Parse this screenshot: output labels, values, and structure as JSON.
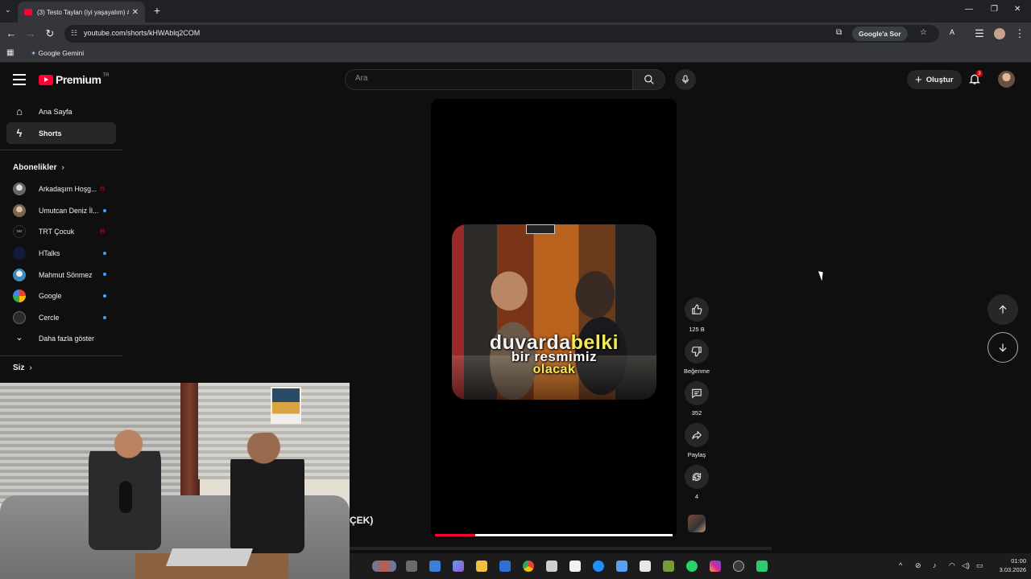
{
  "browser": {
    "tab_title": "(3) Testo Taylan (iyi yaşayalım) #",
    "url": "youtube.com/shorts/kHWAblq2COM",
    "ask_google": "Google'a Sor",
    "bookmark": "Google Gemini"
  },
  "header": {
    "logo": "Premium",
    "logo_region": "TR",
    "search_placeholder": "Ara",
    "create_label": "Oluştur",
    "notification_count": "3"
  },
  "sidebar": {
    "items": [
      {
        "label": "Ana Sayfa",
        "icon": "home-icon"
      },
      {
        "label": "Shorts",
        "icon": "shorts-icon"
      }
    ],
    "subscriptions_title": "Abonelikler",
    "subscriptions": [
      {
        "name": "Arkadaşım Hoşg...",
        "status": "live",
        "color": "#9a9a9a"
      },
      {
        "name": "Umutcan Deniz İl...",
        "status": "new",
        "color": "#b8a28a"
      },
      {
        "name": "TRT Çocuk",
        "status": "live",
        "color": "#1a1a1a"
      },
      {
        "name": "HTalks",
        "status": "new",
        "color": "#1f2a55"
      },
      {
        "name": "Mahmut Sönmez",
        "status": "new",
        "color": "#3c8ab8"
      },
      {
        "name": "Google",
        "status": "new",
        "color": "#ffffff"
      },
      {
        "name": "Cercle",
        "status": "new",
        "color": "#2b2b2b"
      }
    ],
    "show_more": "Daha fazla göster",
    "you_title": "Siz"
  },
  "player": {
    "subtitle_line1_white": "duvarda",
    "subtitle_line1_yellow": "belki",
    "subtitle_line2": "bir resmimiz",
    "subtitle_line3": "olacak",
    "progress_played": 0.17,
    "progress_buffered": 0.0
  },
  "actions": {
    "like_count": "125 B",
    "dislike_label": "Beğenme",
    "comment_count": "352",
    "share_label": "Paylaş",
    "remix_count": "4"
  },
  "overlay": {
    "caption_fragment": "ÇEK)"
  },
  "system": {
    "time": "01:00",
    "date": "3.03.2026"
  },
  "colors": {
    "accent": "#ff0033",
    "subtitle_yellow": "#f3ea55",
    "background": "#0f0f0f"
  }
}
